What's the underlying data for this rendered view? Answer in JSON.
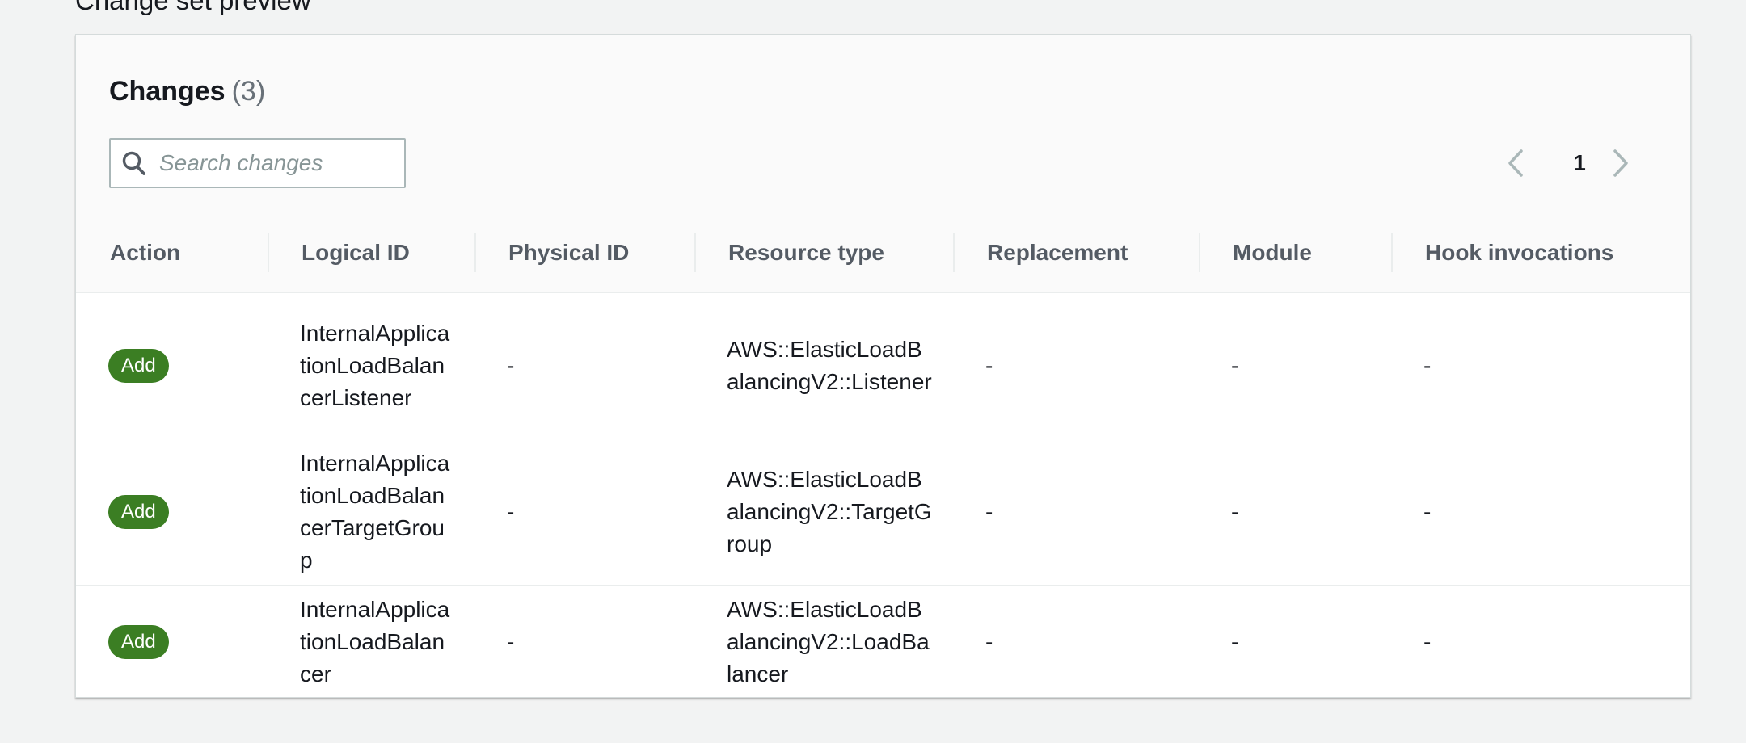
{
  "section": {
    "title": "Change set preview"
  },
  "panel": {
    "title": "Changes",
    "count": "(3)"
  },
  "search": {
    "placeholder": "Search changes",
    "value": ""
  },
  "pagination": {
    "current_page": "1"
  },
  "table": {
    "columns": [
      "Action",
      "Logical ID",
      "Physical ID",
      "Resource type",
      "Replacement",
      "Module",
      "Hook invocations"
    ],
    "rows": [
      {
        "action": "Add",
        "logical_id": "InternalApplicationLoadBalancerListener",
        "physical_id": "-",
        "resource_type": "AWS::ElasticLoadBalancingV2::Listener",
        "replacement": "-",
        "module": "-",
        "hook_invocations": "-"
      },
      {
        "action": "Add",
        "logical_id": "InternalApplicationLoadBalancerTargetGroup",
        "physical_id": "-",
        "resource_type": "AWS::ElasticLoadBalancingV2::TargetGroup",
        "replacement": "-",
        "module": "-",
        "hook_invocations": "-"
      },
      {
        "action": "Add",
        "logical_id": "InternalApplicationLoadBalancer",
        "physical_id": "-",
        "resource_type": "AWS::ElasticLoadBalancingV2::LoadBalancer",
        "replacement": "-",
        "module": "-",
        "hook_invocations": "-"
      }
    ]
  },
  "colors": {
    "add_badge": "#3b7e23",
    "background": "#f2f3f3",
    "header_text": "#545b64"
  },
  "icons": {
    "search": "search-icon",
    "prev": "chevron-left-icon",
    "next": "chevron-right-icon"
  }
}
